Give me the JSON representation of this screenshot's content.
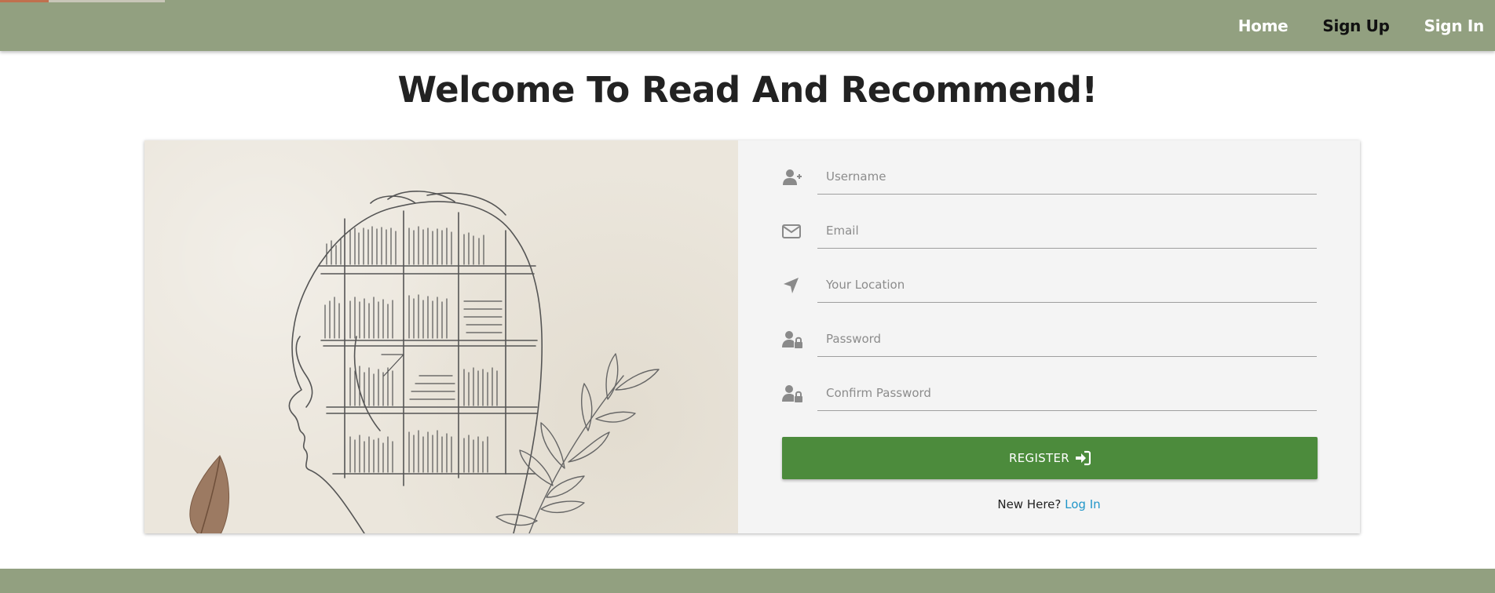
{
  "nav": {
    "items": [
      {
        "label": "Home",
        "active": false
      },
      {
        "label": "Sign Up",
        "active": true
      },
      {
        "label": "Sign In",
        "active": false
      }
    ]
  },
  "page": {
    "title": "Welcome To Read And Recommend!"
  },
  "form": {
    "fields": [
      {
        "icon": "user-plus-icon",
        "placeholder": "Username",
        "value": ""
      },
      {
        "icon": "envelope-icon",
        "placeholder": "Email",
        "value": ""
      },
      {
        "icon": "location-arrow-icon",
        "placeholder": "Your Location",
        "value": ""
      },
      {
        "icon": "user-lock-icon",
        "placeholder": "Password",
        "value": ""
      },
      {
        "icon": "user-lock-icon",
        "placeholder": "Confirm Password",
        "value": ""
      }
    ],
    "register_label": "REGISTER",
    "register_icon": "sign-in-icon",
    "footer_text": "New Here?",
    "footer_link": "Log In"
  },
  "colors": {
    "navbar": "#92a080",
    "button": "#4c8b3c",
    "link": "#2196c9",
    "panel": "#f4f4f4"
  }
}
